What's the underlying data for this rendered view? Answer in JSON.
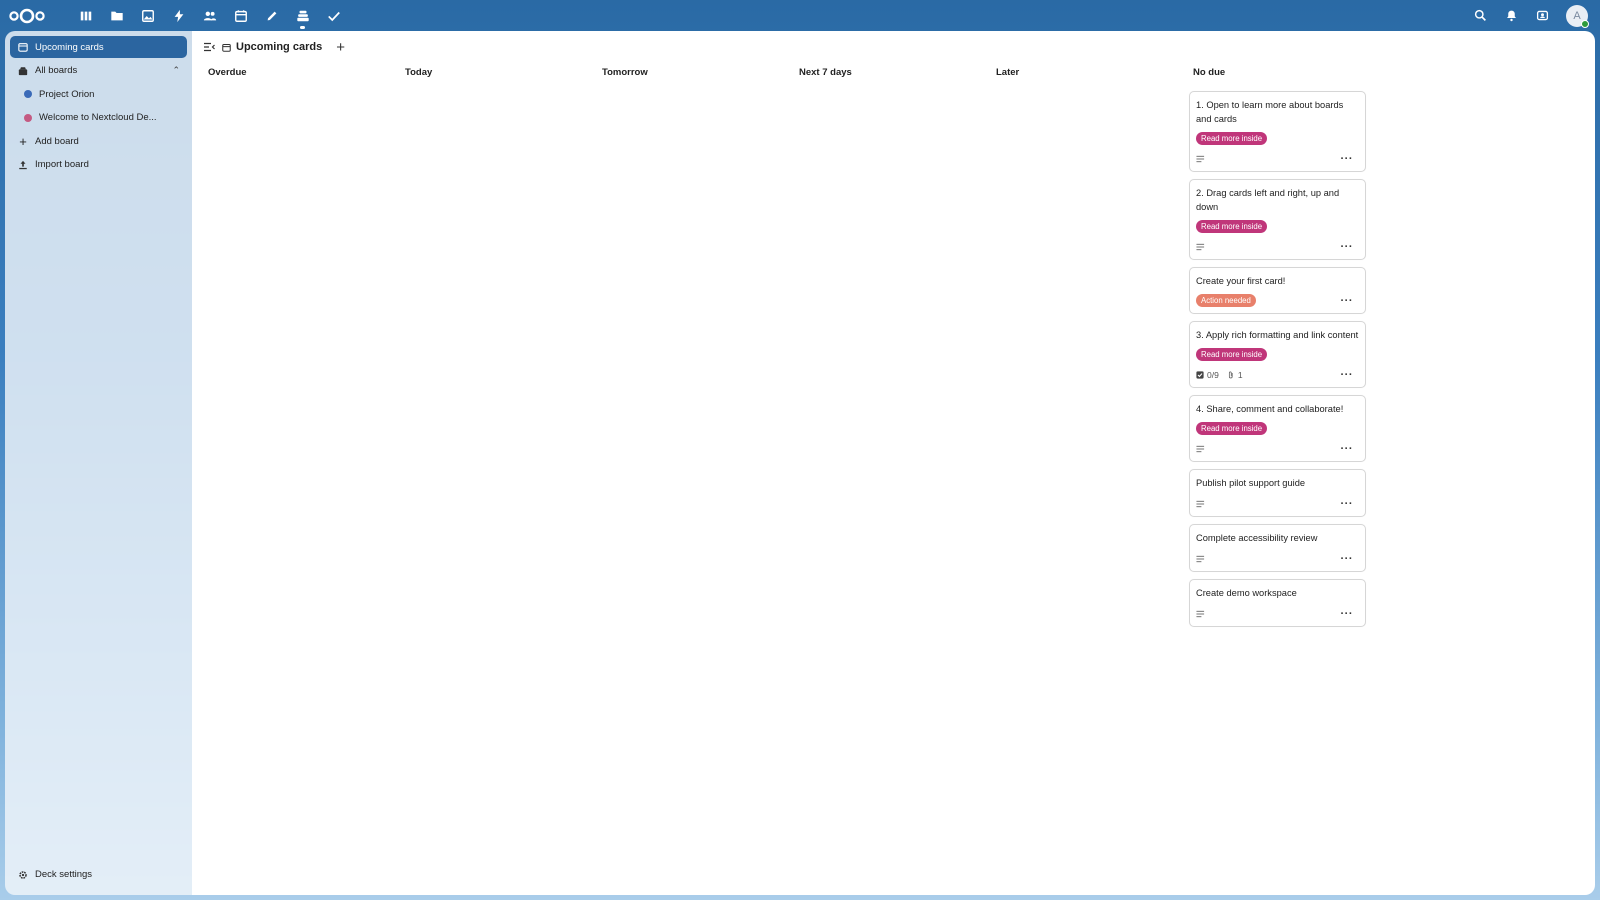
{
  "topbar": {
    "apps": [
      {
        "icon": "dashboard-icon"
      },
      {
        "icon": "files-icon"
      },
      {
        "icon": "photos-icon"
      },
      {
        "icon": "activity-icon"
      },
      {
        "icon": "contacts-icon"
      },
      {
        "icon": "calendar-icon"
      },
      {
        "icon": "notes-icon"
      },
      {
        "icon": "deck-icon",
        "active": true
      },
      {
        "icon": "tasks-icon"
      }
    ],
    "avatar_initial": "A"
  },
  "sidebar": {
    "upcoming": "Upcoming cards",
    "all_boards": "All boards",
    "boards": [
      {
        "label": "Project Orion",
        "color": "#3a6ab8"
      },
      {
        "label": "Welcome to Nextcloud De...",
        "color": "#c45a82"
      }
    ],
    "add_board": "Add board",
    "import_board": "Import board",
    "settings": "Deck settings"
  },
  "header": {
    "title": "Upcoming cards"
  },
  "columns": [
    "Overdue",
    "Today",
    "Tomorrow",
    "Next 7 days",
    "Later",
    "No due"
  ],
  "colors": {
    "read_more": "#c0367a",
    "action_needed": "#e8806b",
    "accent": "#2b65a0"
  },
  "cards": [
    {
      "title": "1. Open to learn more about boards and cards",
      "label": "Read more inside",
      "label_kind": "read_more",
      "has_desc": true
    },
    {
      "title": "2. Drag cards left and right, up and down",
      "label": "Read more inside",
      "label_kind": "read_more",
      "has_desc": true
    },
    {
      "title": "Create your first card!",
      "label": "Action needed",
      "label_kind": "action_needed",
      "has_desc": false
    },
    {
      "title": "3. Apply rich formatting and link content",
      "label": "Read more inside",
      "label_kind": "read_more",
      "checklist": "0/9",
      "attachments": "1"
    },
    {
      "title": "4. Share, comment and collaborate!",
      "label": "Read more inside",
      "label_kind": "read_more",
      "has_desc": true
    },
    {
      "title": "Publish pilot support guide",
      "has_desc": true
    },
    {
      "title": "Complete accessibility review",
      "has_desc": true
    },
    {
      "title": "Create demo workspace",
      "has_desc": true
    }
  ]
}
